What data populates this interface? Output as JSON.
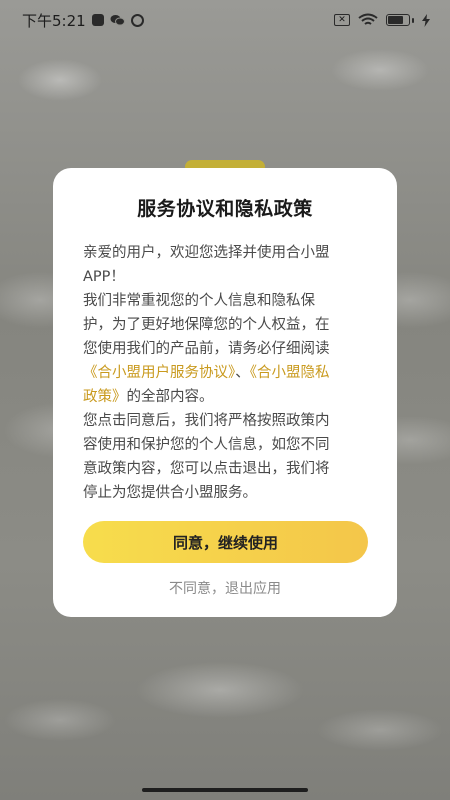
{
  "status_bar": {
    "time": "下午5:21",
    "sim_label": "✕",
    "icons": [
      "notification-square-icon",
      "wechat-icon",
      "camera-icon",
      "sim-off-icon",
      "wifi-icon",
      "battery-icon",
      "charging-icon"
    ]
  },
  "dialog": {
    "title": "服务协议和隐私政策",
    "body": {
      "l1": "亲爱的用户，欢迎您选择并使用合小盟",
      "l2": "APP！",
      "l3": "我们非常重视您的个人信息和隐私保",
      "l4": "护，为了更好地保障您的个人权益，在",
      "l5": "您使用我们的产品前，请务必仔细阅读",
      "link1": "《合小盟用户服务协议》",
      "sep": "、",
      "link2a": "《合小盟隐私",
      "link2b": "政策》",
      "l7": "的全部内容。",
      "l8": "您点击同意后，我们将严格按照政策内",
      "l9": "容使用和保护您的个人信息，如您不同",
      "l10": "意政策内容，您可以点击退出，我们将",
      "l11": "停止为您提供合小盟服务。"
    },
    "agree_label": "同意，继续使用",
    "decline_label": "不同意，退出应用"
  },
  "colors": {
    "accent_button_start": "#f7dd4c",
    "accent_button_end": "#f4c64a",
    "link": "#c99a1e"
  }
}
